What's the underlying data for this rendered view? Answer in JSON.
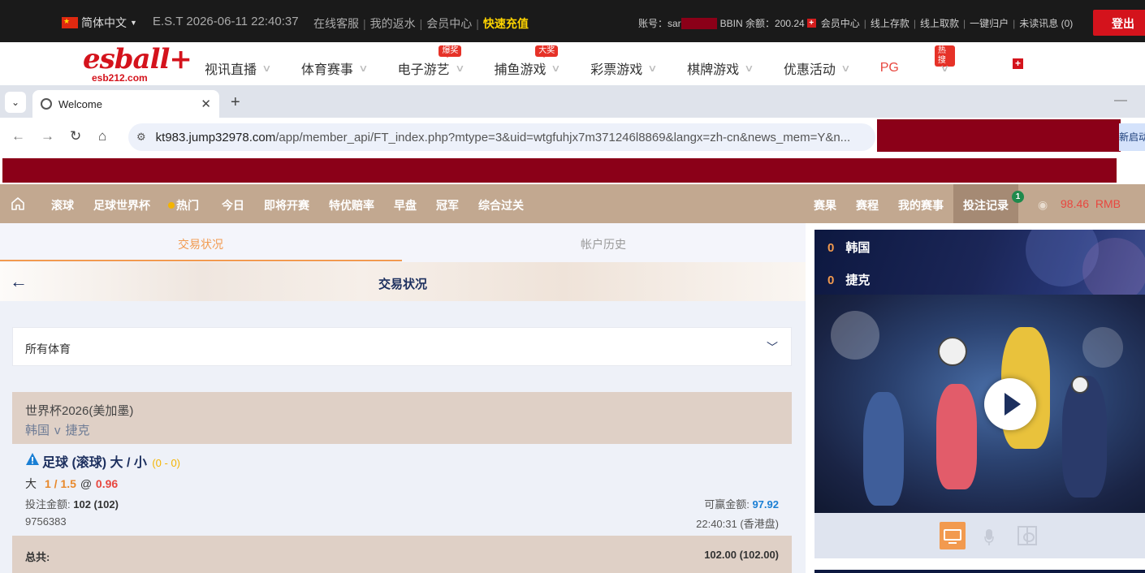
{
  "topbar": {
    "language": "简体中文",
    "est_time": "E.S.T 2026-06-11 22:40:37",
    "links": [
      "在线客服",
      "我的返水",
      "会员中心"
    ],
    "recharge": "快速充值",
    "account_label": "账号：sar",
    "bbin_label": "BBIN 余额：200.24",
    "account_links": [
      "会员中心",
      "线上存款",
      "线上取款",
      "一键归户",
      "未读讯息 (0)"
    ],
    "logout": "登出"
  },
  "brand": {
    "logo": "esball+",
    "domain": "esb212.com",
    "nav": [
      {
        "label": "视讯直播",
        "badge": ""
      },
      {
        "label": "体育赛事",
        "badge": ""
      },
      {
        "label": "电子游艺",
        "badge": "爆奖"
      },
      {
        "label": "捕鱼游戏",
        "badge": "大奖"
      },
      {
        "label": "彩票游戏",
        "badge": ""
      },
      {
        "label": "棋牌游戏",
        "badge": ""
      },
      {
        "label": "优惠活动",
        "badge": ""
      },
      {
        "label": "PG",
        "badge": ""
      },
      {
        "label": "",
        "badge": "热搜"
      }
    ]
  },
  "browser": {
    "tab_title": "Welcome",
    "url_host": "kt983.jump32978.com",
    "url_path": "/app/member_api/FT_index.php?mtype=3&uid=wtgfuhjx7m371246l8869&langx=zh-cn&news_mem=Y&n...",
    "restart": "新启动"
  },
  "sitenav": {
    "items": [
      "滚球",
      "足球世界杯",
      "热门",
      "今日",
      "即将开赛",
      "特优赔率",
      "早盘",
      "冠军",
      "综合过关"
    ],
    "right_items": [
      "赛果",
      "赛程",
      "我的赛事"
    ],
    "bet_record": "投注记录",
    "bet_record_count": "1",
    "balance": "98.46",
    "currency": "RMB"
  },
  "page": {
    "tabs": [
      "交易状况",
      "帐户历史"
    ],
    "title": "交易状况",
    "sport_filter": "所有体育"
  },
  "bet": {
    "league": "世界杯2026(美加墨)",
    "home": "韩国",
    "vs": "v",
    "away": "捷克",
    "title": "足球 (滚球) 大 / 小",
    "score": "(0 - 0)",
    "selection": "大",
    "line": "1 / 1.5",
    "at": "@",
    "odds": "0.96",
    "stake_label": "投注金额:",
    "stake": "102 (102)",
    "win_label": "可赢金额:",
    "win": "97.92",
    "bet_id": "9756383",
    "bet_time": "22:40:31 (香港盘)",
    "total_label": "总共:",
    "total": "102.00 (102.00)"
  },
  "live": {
    "home_score": "0",
    "home": "韩国",
    "away_score": "0",
    "away": "捷克"
  },
  "colors": {
    "accent_orange": "#f29a4f",
    "nav_bg": "#c2a890",
    "brand_red": "#d4131c",
    "navy": "#1c2f5e"
  }
}
